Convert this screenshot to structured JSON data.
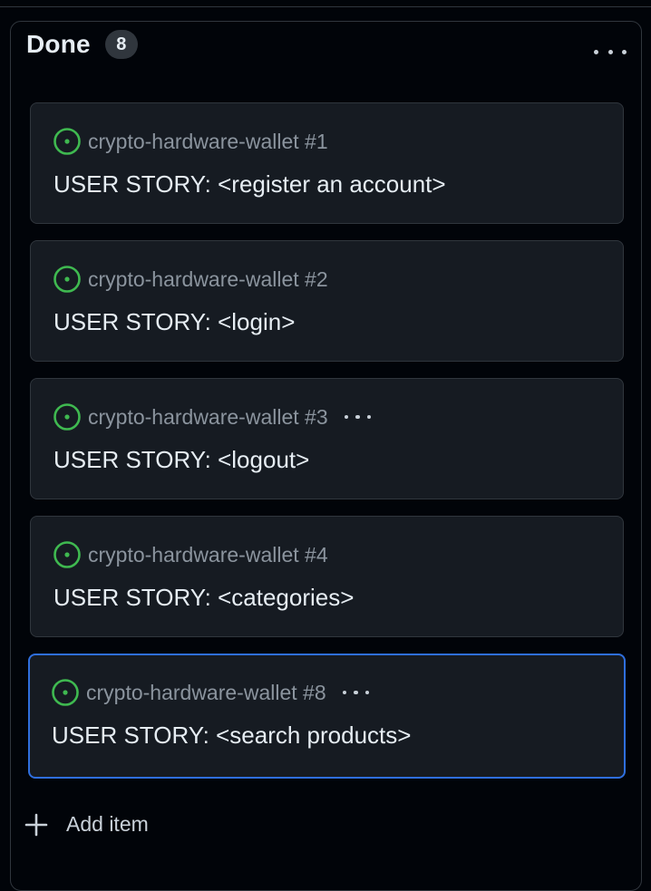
{
  "column": {
    "title": "Done",
    "count": "8",
    "menu_icon": "kebab-horizontal-icon"
  },
  "cards": [
    {
      "ref": "crypto-hardware-wallet #1",
      "title": "USER STORY: <register an account>",
      "status_icon": "issue-open-icon",
      "has_menu": false,
      "selected": false
    },
    {
      "ref": "crypto-hardware-wallet #2",
      "title": "USER STORY: <login>",
      "status_icon": "issue-open-icon",
      "has_menu": false,
      "selected": false
    },
    {
      "ref": "crypto-hardware-wallet #3",
      "title": "USER STORY: <logout>",
      "status_icon": "issue-open-icon",
      "has_menu": true,
      "selected": false
    },
    {
      "ref": "crypto-hardware-wallet #4",
      "title": "USER STORY: <categories>",
      "status_icon": "issue-open-icon",
      "has_menu": false,
      "selected": false
    },
    {
      "ref": "crypto-hardware-wallet #8",
      "title": "USER STORY: <search products>",
      "status_icon": "issue-open-icon",
      "has_menu": true,
      "selected": true
    }
  ],
  "add_item": {
    "label": "Add item",
    "icon": "plus-icon"
  },
  "colors": {
    "background": "#010409",
    "card": "#161b22",
    "border": "#30363d",
    "open_status": "#3fb950",
    "selected_border": "#2f6fde"
  }
}
